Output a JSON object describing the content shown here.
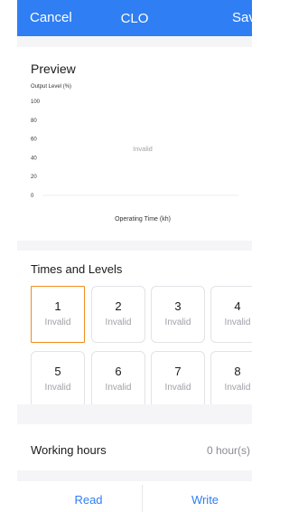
{
  "header": {
    "cancel_label": "Cancel",
    "title": "CLO",
    "save_label": "Save"
  },
  "preview": {
    "title": "Preview",
    "chart_data": {
      "type": "line",
      "title": "",
      "ylabel": "Output Level (%)",
      "xlabel": "Operating Time (kh)",
      "y_ticks": [
        "100",
        "80",
        "60",
        "40",
        "20",
        "0"
      ],
      "ylim": [
        0,
        100
      ],
      "series": [],
      "empty_message": "Invalid",
      "grid": false
    }
  },
  "times_levels": {
    "title": "Times and Levels",
    "tiles": [
      {
        "number": "1",
        "level": "Invalid",
        "selected": true
      },
      {
        "number": "2",
        "level": "Invalid",
        "selected": false
      },
      {
        "number": "3",
        "level": "Invalid",
        "selected": false
      },
      {
        "number": "4",
        "level": "Invalid",
        "selected": false
      },
      {
        "number": "5",
        "level": "Invalid",
        "selected": false
      },
      {
        "number": "6",
        "level": "Invalid",
        "selected": false
      },
      {
        "number": "7",
        "level": "Invalid",
        "selected": false
      },
      {
        "number": "8",
        "level": "Invalid",
        "selected": false
      }
    ]
  },
  "working_hours": {
    "label": "Working hours",
    "value": "0 hour(s)"
  },
  "actions": {
    "read_label": "Read",
    "write_label": "Write"
  },
  "colors": {
    "accent": "#2f7ef3",
    "selected_border": "#f08c1f",
    "muted_text": "#a0a0a8"
  }
}
